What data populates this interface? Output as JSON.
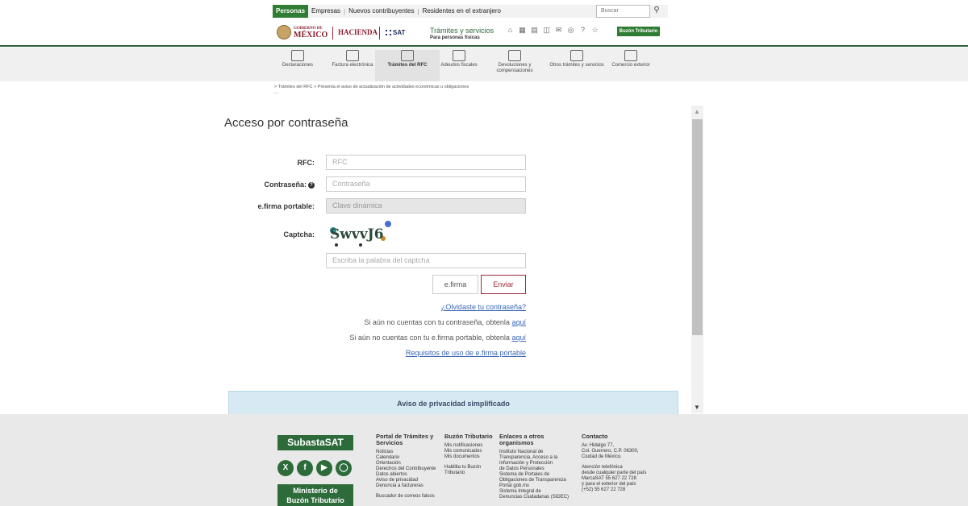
{
  "topbar": {
    "tabs": [
      "Personas",
      "Empresas",
      "Nuevos contribuyentes",
      "Residentes en el extranjero"
    ],
    "search_placeholder": "Buscar"
  },
  "header": {
    "gob_small": "GOBIERNO DE",
    "gob_big": "MÉXICO",
    "hacienda": "HACIENDA",
    "sat": "SAT",
    "title": "Trámites y servicios",
    "subtitle": "Para personas físicas",
    "buzon_button": "Buzón Tributario",
    "icons": [
      "home-icon",
      "calendar-icon",
      "building-icon",
      "book-icon",
      "mail-icon",
      "compass-icon",
      "help-icon",
      "accessibility-icon"
    ]
  },
  "nav": {
    "items": [
      {
        "label": "Declaraciones",
        "icon": "declaraciones-icon"
      },
      {
        "label": "Factura electrónica",
        "icon": "factura-icon"
      },
      {
        "label": "Trámites del RFC",
        "icon": "rfc-icon"
      },
      {
        "label": "Adeudos fiscales",
        "icon": "adeudos-icon"
      },
      {
        "label": "Devoluciones y compensaciones",
        "icon": "devoluciones-icon"
      },
      {
        "label": "Otros trámites y servicios",
        "icon": "otros-icon"
      },
      {
        "label": "Comercio exterior",
        "icon": "comercio-icon"
      }
    ]
  },
  "breadcrumb": {
    "text": "> Trámites del RFC > Presenta el aviso de actualización de actividades económicas u obligaciones",
    "dots": "..."
  },
  "form": {
    "title": "Acceso por contraseña",
    "rfc_label": "RFC:",
    "rfc_placeholder": "RFC",
    "password_label": "Contraseña:",
    "password_placeholder": "Contraseña",
    "efirma_label": "e.firma portable:",
    "efirma_placeholder": "Clave dinámica",
    "captcha_label": "Captcha:",
    "captcha_text": "SwvvJ6",
    "captcha_placeholder": "Escriba la palabra del captcha",
    "btn_efirma": "e.firma",
    "btn_enviar": "Enviar",
    "forgot_link": "¿Olvidaste tu contraseña?",
    "no_password_text": "Si aún no cuentas con tu contraseña, obtenla",
    "no_password_link": "aquí",
    "no_efirma_text": "Si aún no cuentas con tu e.firma portable, obtenla",
    "no_efirma_link": "aquí",
    "requisitos_link": "Requisitos de uso de e.firma portable",
    "privacy_title": "Aviso de privacidad simplificado"
  },
  "footer": {
    "subasta": "SubastaSAT",
    "social": [
      "x-icon",
      "facebook-icon",
      "youtube-icon",
      "instagram-icon"
    ],
    "ministerio_line1": "Ministerio de",
    "ministerio_line2": "Buzón Tributario",
    "col1_title": "Portal de Trámites y Servicios",
    "col1_items": [
      "Noticias",
      "Calendario",
      "Orientación",
      "Derechos del Contribuyente",
      "Datos abiertos",
      "Aviso de privacidad",
      "Denuncia a factureras"
    ],
    "col1_extra": "Buscador de correos falsos",
    "col2_title": "Buzón Tributario",
    "col2_items": [
      "Mis notificaciones",
      "Mis comunicados",
      "Mis documentos"
    ],
    "col2_extra": [
      "Habilita tu Buzón",
      "Tributario"
    ],
    "col3_title": "Enlaces a otros organismos",
    "col3_items": [
      "Instituto Nacional de",
      "Transparencia, Acceso a la",
      "Información y Protección",
      "de Datos Personales",
      "Sistema de Portales de",
      "Obligaciones de Transparencia",
      "Portal gob.mx",
      "Sistema Integral de",
      "Denuncias Ciudadanas (SIDEC)"
    ],
    "col4_title": "Contacto",
    "col4_address": [
      "Av. Hidalgo 77,",
      "Col. Guerrero, C.P. 06300,",
      "Ciudad de México."
    ],
    "col4_phone": [
      "Atención telefónica",
      "desde cualquier parte del país",
      "MarcaSAT 55 627 22 728",
      "y para el exterior del país",
      "(+52) 55 627 22 728"
    ]
  }
}
